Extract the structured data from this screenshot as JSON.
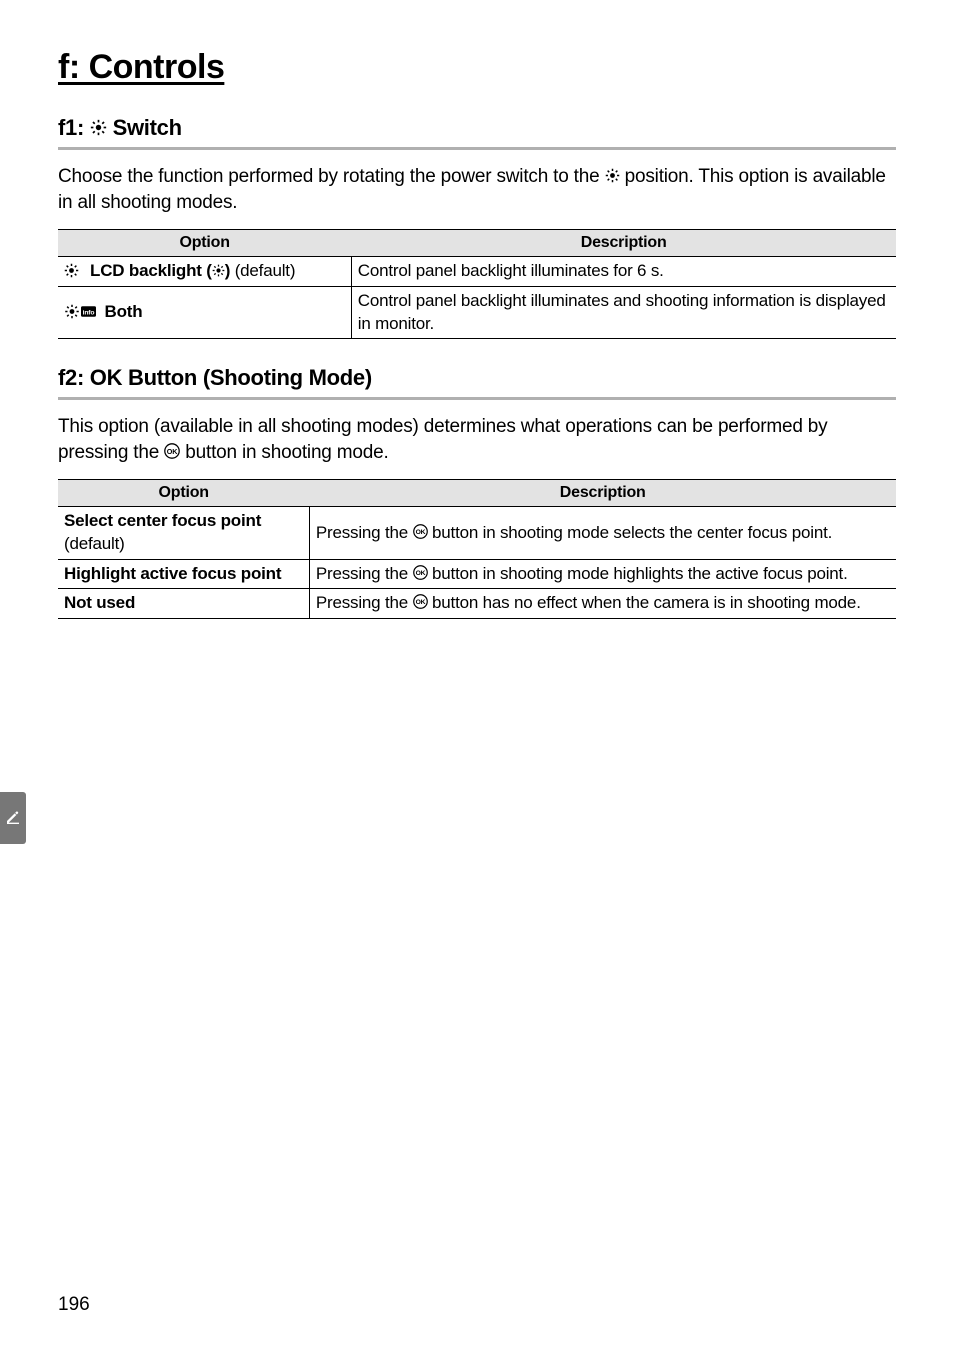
{
  "title": "f: Controls",
  "section_f1": {
    "heading_prefix": "f1: ",
    "heading_suffix": " Switch",
    "para_part1": "Choose the function performed by rotating the power switch to the ",
    "para_part2": " position.  This option is available in all shooting modes.",
    "table": {
      "headers": {
        "option": "Option",
        "description": "Description"
      },
      "row1": {
        "opt_bold": "LCD backlight (",
        "opt_bold_close": ")",
        "opt_rest": " (default)",
        "desc": "Control panel backlight illuminates for 6 s."
      },
      "row2": {
        "opt": "Both",
        "desc": "Control panel backlight illuminates and shooting information is displayed in monitor."
      }
    }
  },
  "section_f2": {
    "heading": "f2: OK Button (Shooting Mode)",
    "para_part1": "This option (available in all shooting modes) determines what operations can be performed by pressing the ",
    "para_part2": " button in shooting mode.",
    "table": {
      "headers": {
        "option": "Option",
        "description": "Description"
      },
      "row1": {
        "opt_line1": "Select center focus point",
        "opt_line2": "(default)",
        "desc_part1": "Pressing the ",
        "desc_part2": " button in shooting mode selects the center focus point."
      },
      "row2": {
        "opt": "Highlight active focus point",
        "desc_part1": "Pressing the ",
        "desc_part2": " button in shooting mode highlights the active focus point."
      },
      "row3": {
        "opt": "Not used",
        "desc_part1": "Pressing the ",
        "desc_part2": " button has no effect when the camera is in shooting mode."
      }
    }
  },
  "page_number": "196"
}
